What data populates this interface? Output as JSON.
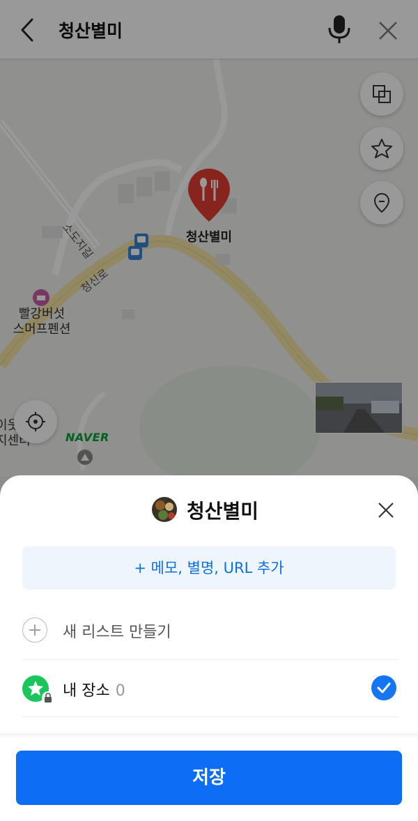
{
  "topbar": {
    "search_query": "청산별미"
  },
  "map": {
    "place_label": "청산별미",
    "poi_label": "빨강버섯\n스머프펜션",
    "road_label_1": "소도지길",
    "road_label_2": "청신로",
    "partial_label": "이웃\n지센터",
    "naver_logo": "NAVER"
  },
  "sheet": {
    "title": "청산별미",
    "add_memo": "+ 메모, 별명, URL 추가",
    "new_list": "새 리스트 만들기",
    "list_items": [
      {
        "label": "내 장소",
        "count": "0",
        "checked": true
      }
    ],
    "save": "저장"
  },
  "colors": {
    "accent": "#0d6ef5",
    "list_green": "#1cc45c",
    "pin_red": "#e23c31",
    "naver_green": "#03a13a"
  },
  "icons": [
    "back-arrow-icon",
    "microphone-icon",
    "close-icon",
    "layers-icon",
    "star-icon",
    "location-pin-icon",
    "current-location-icon",
    "restaurant-pin-icon",
    "bus-stop-icon",
    "lock-icon",
    "check-icon",
    "plus-icon"
  ]
}
